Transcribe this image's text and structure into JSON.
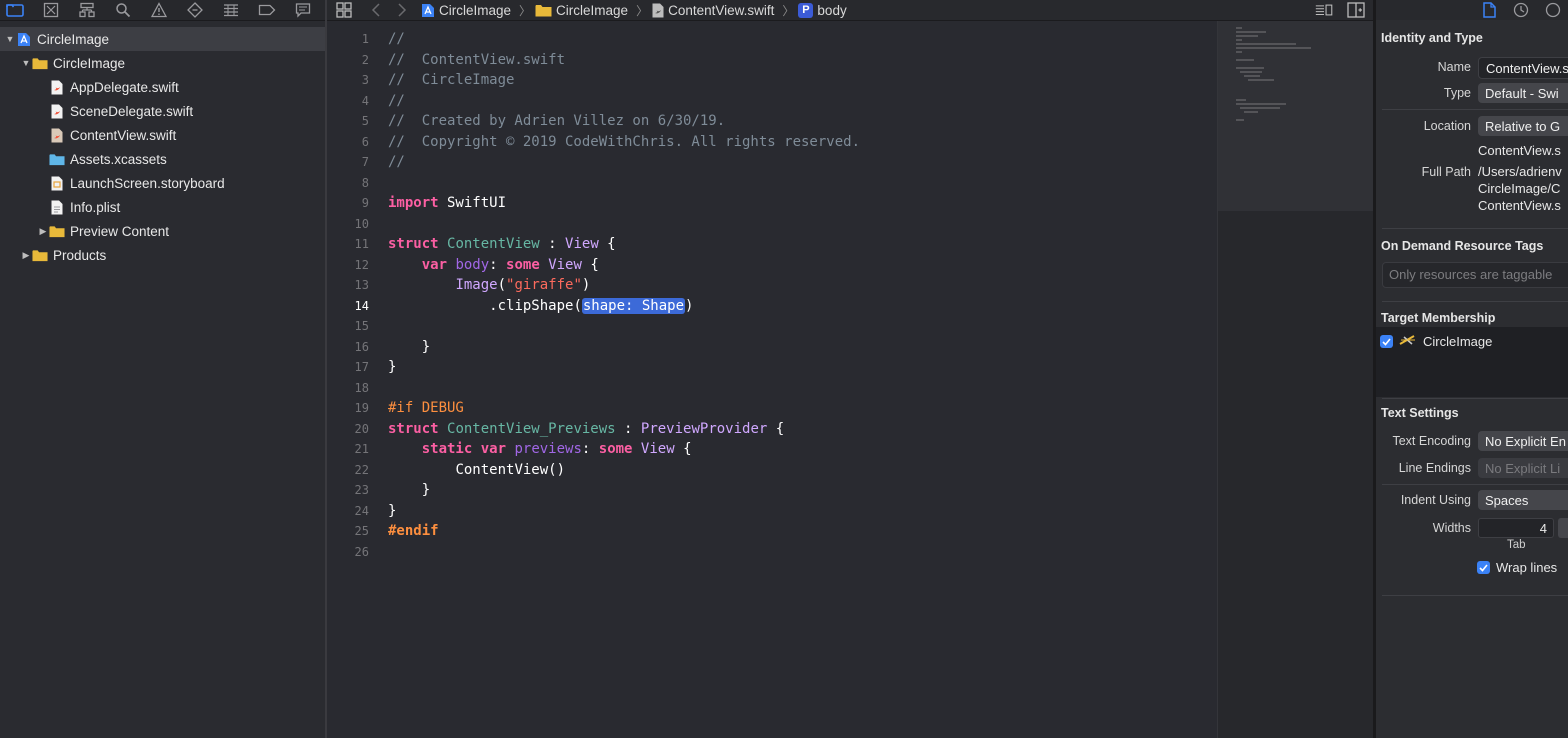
{
  "navigator": {
    "items": [
      {
        "label": "CircleImage",
        "depth": 0,
        "disclosure": "open",
        "icon": "project-icon",
        "selected": true
      },
      {
        "label": "CircleImage",
        "depth": 1,
        "disclosure": "open",
        "icon": "folder-icon"
      },
      {
        "label": "AppDelegate.swift",
        "depth": 2,
        "disclosure": "none",
        "icon": "swift-file-icon"
      },
      {
        "label": "SceneDelegate.swift",
        "depth": 2,
        "disclosure": "none",
        "icon": "swift-file-icon"
      },
      {
        "label": "ContentView.swift",
        "depth": 2,
        "disclosure": "none",
        "icon": "swift-file-icon"
      },
      {
        "label": "Assets.xcassets",
        "depth": 2,
        "disclosure": "none",
        "icon": "asset-catalog-icon"
      },
      {
        "label": "LaunchScreen.storyboard",
        "depth": 2,
        "disclosure": "none",
        "icon": "storyboard-icon"
      },
      {
        "label": "Info.plist",
        "depth": 2,
        "disclosure": "none",
        "icon": "plist-icon"
      },
      {
        "label": "Preview Content",
        "depth": 2,
        "disclosure": "closed",
        "icon": "folder-icon"
      },
      {
        "label": "Products",
        "depth": 1,
        "disclosure": "closed",
        "icon": "folder-icon"
      }
    ]
  },
  "jumpbar": {
    "crumbs": [
      "CircleImage",
      "CircleImage",
      "ContentView.swift",
      "body"
    ]
  },
  "editor": {
    "current_line": 14,
    "line_numbers": [
      "1",
      "2",
      "3",
      "4",
      "5",
      "6",
      "7",
      "8",
      "9",
      "10",
      "11",
      "12",
      "13",
      "14",
      "15",
      "16",
      "17",
      "18",
      "19",
      "20",
      "21",
      "22",
      "23",
      "24",
      "25",
      "26"
    ],
    "lines": {
      "l1": "//",
      "l2": "//  ContentView.swift",
      "l3": "//  CircleImage",
      "l4": "//",
      "l5": "//  Created by Adrien Villez on 6/30/19.",
      "l6": "//  Copyright © 2019 CodeWithChris. All rights reserved.",
      "l7": "//",
      "l9_kw": "import",
      "l9_rest": " SwiftUI",
      "l11_kw": "struct",
      "l11_name": "ContentView",
      "l11_colon": " : ",
      "l11_type": "View",
      "l11_brace": " {",
      "l12_kw1": "var",
      "l12_name": "body",
      "l12_colon": ": ",
      "l12_kw2": "some",
      "l12_type": "View",
      "l12_brace": " {",
      "l13_call": "Image",
      "l13_open": "(",
      "l13_str": "\"giraffe\"",
      "l13_close": ")",
      "l14_dot": ".clipShape(",
      "l14_ph": "shape: Shape",
      "l14_close": ")",
      "l16": "}",
      "l17": "}",
      "l19": "#if DEBUG",
      "l20_kw": "struct",
      "l20_name": "ContentView_Previews",
      "l20_colon": " : ",
      "l20_type": "PreviewProvider",
      "l20_brace": " {",
      "l21_kw1": "static",
      "l21_kw2": "var",
      "l21_name": "previews",
      "l21_colon": ": ",
      "l21_kw3": "some",
      "l21_type": "View",
      "l21_brace": " {",
      "l22_call": "ContentView",
      "l22_paren": "()",
      "l23": "}",
      "l24": "}",
      "l25": "#endif"
    }
  },
  "inspector": {
    "identity": {
      "title": "Identity and Type",
      "name_label": "Name",
      "name_value": "ContentView.s",
      "type_label": "Type",
      "type_value": "Default - Swi",
      "location_label": "Location",
      "location_value": "Relative to G",
      "location_file": "ContentView.s",
      "fullpath_label": "Full Path",
      "fullpath_1": "/Users/adrienv",
      "fullpath_2": "CircleImage/C",
      "fullpath_3": "ContentView.s"
    },
    "tags": {
      "title": "On Demand Resource Tags",
      "placeholder": "Only resources are taggable"
    },
    "membership": {
      "title": "Target Membership",
      "target": "CircleImage",
      "checked": true
    },
    "text": {
      "title": "Text Settings",
      "encoding_label": "Text Encoding",
      "encoding_value": "No Explicit En",
      "endings_label": "Line Endings",
      "endings_value": "No Explicit Li",
      "indent_label": "Indent Using",
      "indent_value": "Spaces",
      "widths_label": "Widths",
      "widths_value": "4",
      "tab_label": "Tab",
      "wrap_label": "Wrap lines",
      "wrap_checked": true
    }
  },
  "colors": {
    "accent": "#3b82f6",
    "placeholder_highlight": "#3c6ad8",
    "folder": "#e8b93a",
    "keyword": "#fc5fa3",
    "comment": "#7f8c98"
  }
}
